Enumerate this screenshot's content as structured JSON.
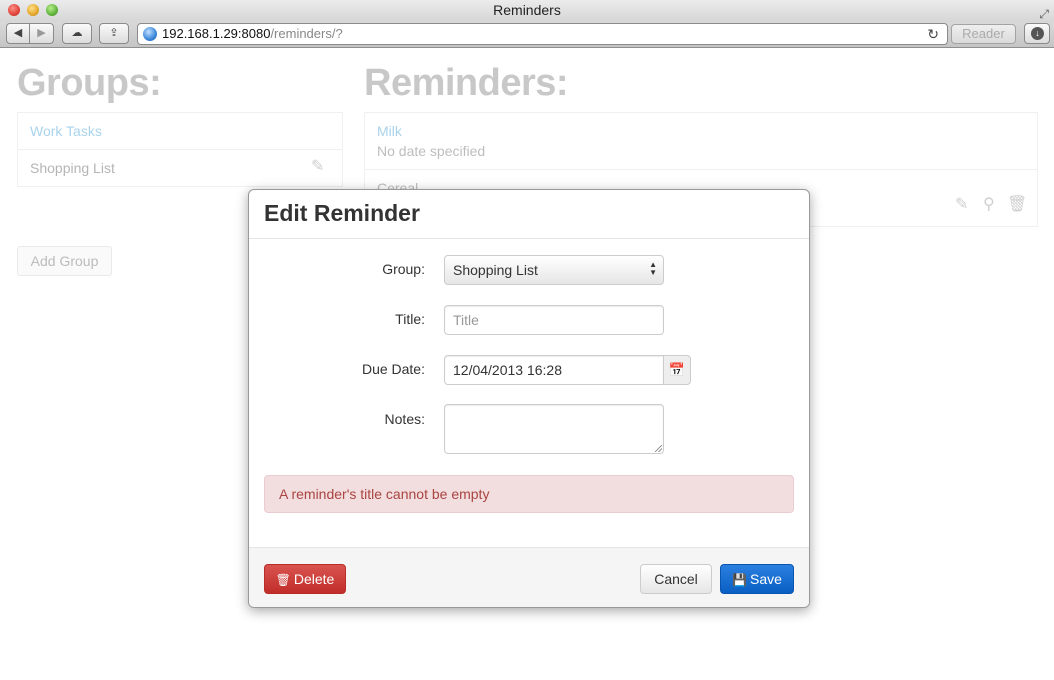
{
  "window": {
    "title": "Reminders",
    "url_host": "192.168.1.29:8080",
    "url_path": "/reminders/?",
    "reader_label": "Reader",
    "icons": [
      "back-arrow-icon",
      "forward-arrow-icon",
      "icloud-icon",
      "share-icon",
      "globe-icon",
      "reload-icon",
      "download-icon",
      "fullscreen-icon"
    ]
  },
  "groups": {
    "heading": "Groups:",
    "items": [
      {
        "label": "Work Tasks"
      },
      {
        "label": "Shopping List"
      }
    ],
    "add_label": "Add Group"
  },
  "reminders": {
    "heading": "Reminders:",
    "items": [
      {
        "title": "Milk",
        "date": "No date specified"
      },
      {
        "title": "Cereal",
        "date": ""
      }
    ]
  },
  "modal": {
    "title": "Edit Reminder",
    "fields": {
      "group_label": "Group:",
      "group_value": "Shopping List",
      "title_label": "Title:",
      "title_value": "",
      "title_placeholder": "Title",
      "due_label": "Due Date:",
      "due_value": "12/04/2013 16:28",
      "notes_label": "Notes:",
      "notes_value": ""
    },
    "error": "A reminder's title cannot be empty",
    "buttons": {
      "delete": "Delete",
      "cancel": "Cancel",
      "save": "Save"
    }
  },
  "colors": {
    "danger": "#d9534f",
    "primary": "#0a5fc4",
    "alert_bg": "#f2dede",
    "alert_text": "#a94442"
  }
}
